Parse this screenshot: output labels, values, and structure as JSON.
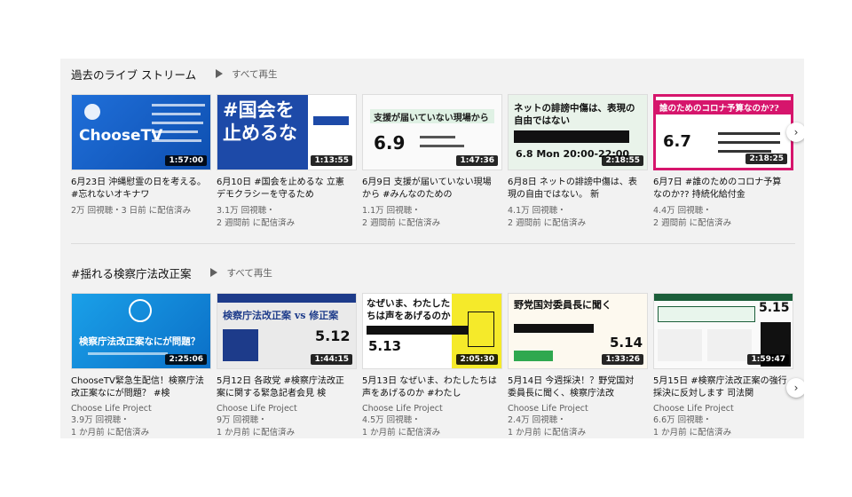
{
  "shelves": [
    {
      "title": "過去のライブ ストリーム",
      "play_all": "すべて再生",
      "videos": [
        {
          "title": "6月23日 沖縄慰霊の日を考える。 #忘れないオキナワ",
          "views": "2万 回視聴・3 日前 に配信済み",
          "meta2": "",
          "duration": "1:57:00",
          "thumb_text": "ChooseTV"
        },
        {
          "title": "6月10日 #国会を止めるな 立憲デモクラシーを守るため",
          "views": "3.1万 回視聴・",
          "meta2": "2 週間前 に配信済み",
          "duration": "1:13:55",
          "thumb_text": "#国会を止めるな"
        },
        {
          "title": "6月9日 支援が届いていない現場から #みんなのための",
          "views": "1.1万 回視聴・",
          "meta2": "2 週間前 に配信済み",
          "duration": "1:47:36",
          "thumb_text": "支援が届いていない現場から"
        },
        {
          "title": "6月8日 ネットの誹謗中傷は、表現の自由ではない。 新",
          "views": "4.1万 回視聴・",
          "meta2": "2 週間前 に配信済み",
          "duration": "2:18:55",
          "thumb_text": "ネットの誹謗中傷は、表現の自由ではない"
        },
        {
          "title": "6月7日 #誰のためのコロナ予算 なのか?? 持続化給付金",
          "views": "4.4万 回視聴・",
          "meta2": "2 週間前 に配信済み",
          "duration": "2:18:25",
          "thumb_text": "誰のためのコロナ予算なのか??"
        }
      ]
    },
    {
      "title": "#揺れる検察庁法改正案",
      "play_all": "すべて再生",
      "videos": [
        {
          "title": "ChooseTV緊急生配信！検察庁法改正案なにが問題？ #検",
          "channel": "Choose Life Project",
          "views": "3.9万 回視聴・",
          "meta2": "1 か月前 に配信済み",
          "duration": "2:25:06",
          "thumb_text": "検察庁法改正案なにが問題？"
        },
        {
          "title": "5月12日 各政党 #検察庁法改正案に関する緊急記者会見 検",
          "channel": "Choose Life Project",
          "views": "9万 回視聴・",
          "meta2": "1 か月前 に配信済み",
          "duration": "1:44:15",
          "thumb_text": "検察庁法改正案 vs 修正案"
        },
        {
          "title": "5月13日 なぜいま、わたしたちは声をあげるのか #わたし",
          "channel": "Choose Life Project",
          "views": "4.5万 回視聴・",
          "meta2": "1 か月前 に配信済み",
          "duration": "2:05:30",
          "thumb_text": "なぜいま、わたしたちは声をあげるのか"
        },
        {
          "title": "5月14日 今週採決！？野党国対委員長に聞く、検察庁法改",
          "channel": "Choose Life Project",
          "views": "2.4万 回視聴・",
          "meta2": "1 か月前 に配信済み",
          "duration": "1:33:26",
          "thumb_text": "野党国対委員長に聞く"
        },
        {
          "title": "5月15日 #検察庁法改正案の強行採決に反対します 司法関",
          "channel": "Choose Life Project",
          "views": "6.6万 回視聴・",
          "meta2": "1 か月前 に配信済み",
          "duration": "1:59:47",
          "thumb_text": "5.15"
        }
      ]
    }
  ],
  "next_icon": "chevron-right-icon",
  "play_icon": "play-icon"
}
